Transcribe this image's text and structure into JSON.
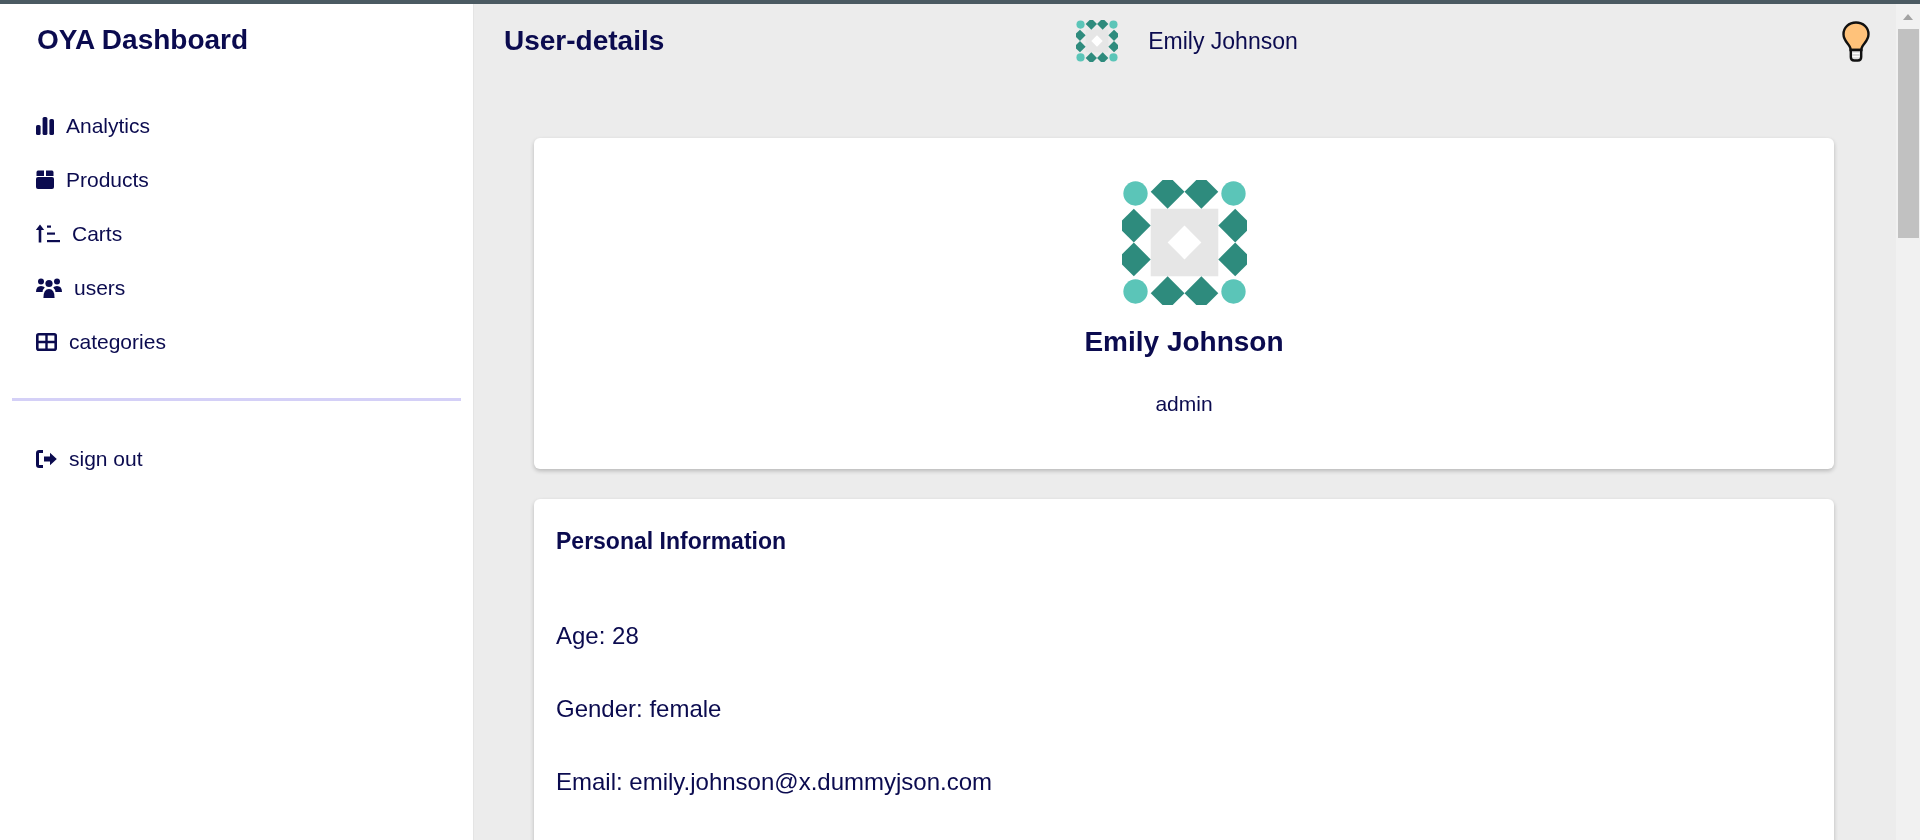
{
  "sidebar": {
    "title": "OYA Dashboard",
    "nav_items": [
      "Analytics",
      "Products",
      "Carts",
      "users",
      "categories"
    ],
    "footer_items": [
      "sign out"
    ]
  },
  "header": {
    "title": "User-details",
    "user_name": "Emily Johnson"
  },
  "profile_card": {
    "name": "Emily Johnson",
    "role": "admin"
  },
  "personal_information": {
    "title": "Personal Information",
    "lines": [
      "Age: 28",
      "Gender: female",
      "Email: emily.johnson@x.dummyjson.com"
    ]
  }
}
